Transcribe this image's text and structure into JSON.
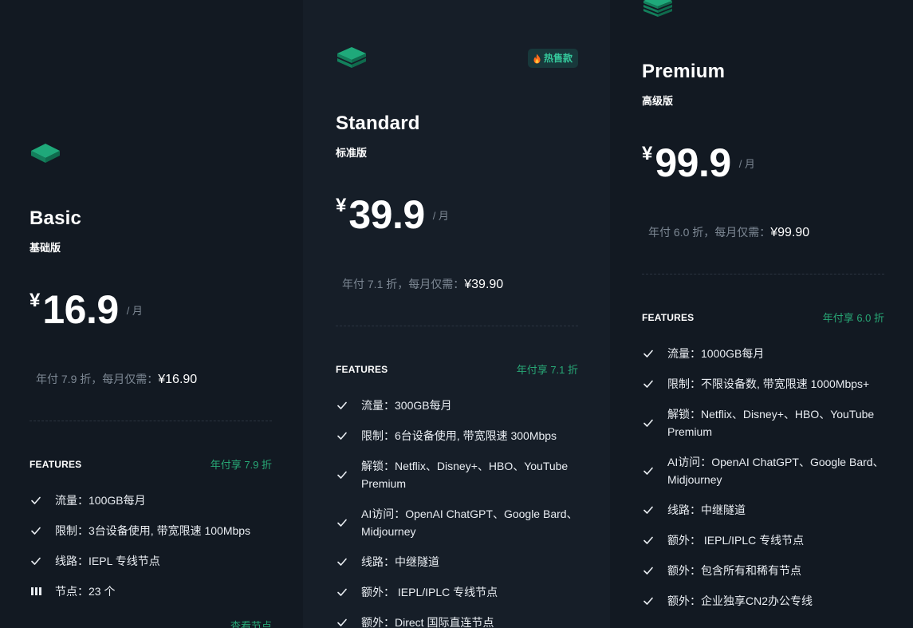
{
  "colors": {
    "accent": "#28a876",
    "badge_bg": "#18383b",
    "background": "#131a23"
  },
  "plans": {
    "basic": {
      "name": "Basic",
      "subtitle": "基础版",
      "currency": "¥",
      "price": "16.9",
      "per": "/ 月",
      "annual_text": "年付 7.9 折，每月仅需：",
      "annual_price": "¥16.90",
      "features_title": "FEATURES",
      "discount": "年付享 7.9 折",
      "features": [
        "流量：100GB每月",
        "限制：3台设备使用, 带宽限速 100Mbps",
        "线路：IEPL 专线节点",
        "节点：23 个"
      ],
      "view_nodes": "查看节点"
    },
    "standard": {
      "badge": "热售款",
      "name": "Standard",
      "subtitle": "标准版",
      "currency": "¥",
      "price": "39.9",
      "per": "/ 月",
      "annual_text": "年付 7.1 折，每月仅需：",
      "annual_price": "¥39.90",
      "features_title": "FEATURES",
      "discount": "年付享 7.1 折",
      "features": [
        "流量：300GB每月",
        "限制：6台设备使用, 带宽限速 300Mbps",
        "解锁：Netflix、Disney+、HBO、YouTube Premium",
        "AI访问：OpenAI ChatGPT、Google Bard、Midjourney",
        "线路：中继隧道",
        "额外： IEPL/IPLC 专线节点",
        "额外：Direct 国际直连节点"
      ]
    },
    "premium": {
      "name": "Premium",
      "subtitle": "高级版",
      "currency": "¥",
      "price": "99.9",
      "per": "/ 月",
      "annual_text": "年付 6.0 折，每月仅需：",
      "annual_price": "¥99.90",
      "features_title": "FEATURES",
      "discount": "年付享 6.0 折",
      "features": [
        "流量：1000GB每月",
        "限制：不限设备数, 带宽限速 1000Mbps+",
        "解锁：Netflix、Disney+、HBO、YouTube Premium",
        "AI访问：OpenAI ChatGPT、Google Bard、Midjourney",
        "线路：中继隧道",
        "额外： IEPL/IPLC 专线节点",
        "额外：包含所有和稀有节点",
        "额外：企业独享CN2办公专线"
      ]
    }
  }
}
